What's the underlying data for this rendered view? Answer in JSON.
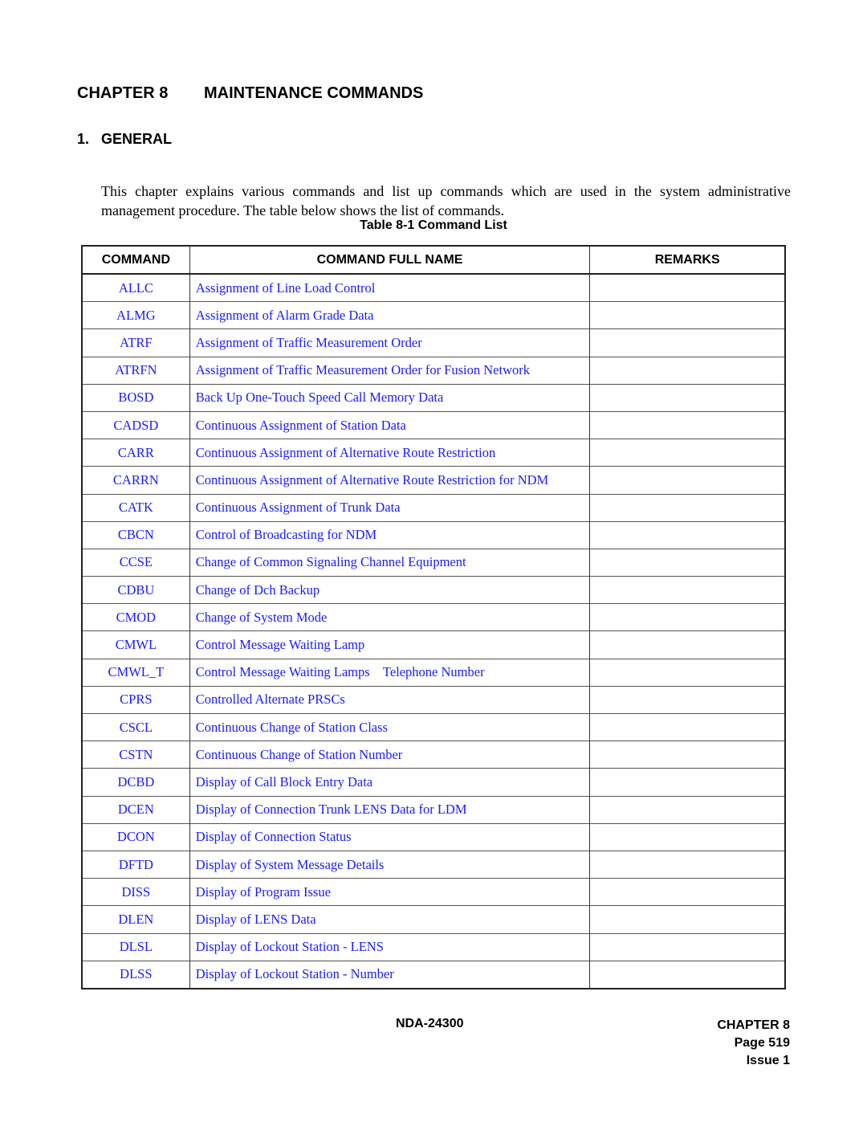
{
  "chapter": {
    "number_label": "CHAPTER 8",
    "title": "MAINTENANCE COMMANDS"
  },
  "section": {
    "number": "1.",
    "title": "GENERAL"
  },
  "intro_text": "This chapter explains various commands and list up commands which are used in the system administrative management procedure. The table below shows the list of commands.",
  "table": {
    "caption": "Table 8-1  Command List",
    "headers": [
      "COMMAND",
      "COMMAND FULL NAME",
      "REMARKS"
    ],
    "rows": [
      {
        "command": "ALLC",
        "full_name": "Assignment of Line Load Control",
        "remarks": ""
      },
      {
        "command": "ALMG",
        "full_name": "Assignment of Alarm Grade Data",
        "remarks": ""
      },
      {
        "command": "ATRF",
        "full_name": "Assignment of Traffic Measurement Order",
        "remarks": ""
      },
      {
        "command": "ATRFN",
        "full_name": "Assignment of Traffic Measurement Order for Fusion Network",
        "remarks": ""
      },
      {
        "command": "BOSD",
        "full_name": "Back Up One-Touch Speed Call Memory Data",
        "remarks": ""
      },
      {
        "command": "CADSD",
        "full_name": "Continuous Assignment of Station Data",
        "remarks": ""
      },
      {
        "command": "CARR",
        "full_name": "Continuous Assignment of Alternative Route Restriction",
        "remarks": ""
      },
      {
        "command": "CARRN",
        "full_name": "Continuous Assignment of Alternative Route Restriction for NDM",
        "remarks": ""
      },
      {
        "command": "CATK",
        "full_name": "Continuous Assignment of Trunk Data",
        "remarks": ""
      },
      {
        "command": "CBCN",
        "full_name": "Control of Broadcasting for NDM",
        "remarks": ""
      },
      {
        "command": "CCSE",
        "full_name": "Change of Common Signaling Channel Equipment",
        "remarks": ""
      },
      {
        "command": "CDBU",
        "full_name": "Change of Dch Backup",
        "remarks": ""
      },
      {
        "command": "CMOD",
        "full_name": "Change of System Mode",
        "remarks": ""
      },
      {
        "command": "CMWL",
        "full_name": "Control Message Waiting Lamp",
        "remarks": ""
      },
      {
        "command": "CMWL_T",
        "full_name": "Control Message Waiting Lamps    Telephone Number",
        "remarks": ""
      },
      {
        "command": "CPRS",
        "full_name": "Controlled Alternate PRSCs",
        "remarks": ""
      },
      {
        "command": "CSCL",
        "full_name": "Continuous Change of Station Class",
        "remarks": ""
      },
      {
        "command": "CSTN",
        "full_name": "Continuous Change of Station Number",
        "remarks": ""
      },
      {
        "command": "DCBD",
        "full_name": "Display of Call Block Entry Data",
        "remarks": ""
      },
      {
        "command": "DCEN",
        "full_name": "Display of Connection Trunk LENS Data for LDM",
        "remarks": ""
      },
      {
        "command": "DCON",
        "full_name": "Display of Connection Status",
        "remarks": ""
      },
      {
        "command": "DFTD",
        "full_name": "Display of System Message Details",
        "remarks": ""
      },
      {
        "command": "DISS",
        "full_name": "Display of Program Issue",
        "remarks": ""
      },
      {
        "command": "DLEN",
        "full_name": "Display of LENS Data",
        "remarks": ""
      },
      {
        "command": "DLSL",
        "full_name": "Display of Lockout Station - LENS",
        "remarks": ""
      },
      {
        "command": "DLSS",
        "full_name": "Display of Lockout Station - Number",
        "remarks": ""
      }
    ]
  },
  "footer": {
    "doc_number": "NDA-24300",
    "chapter": "CHAPTER 8",
    "page": "Page 519",
    "issue": "Issue 1"
  },
  "colors": {
    "link": "#1a1aff",
    "text": "#000000"
  }
}
